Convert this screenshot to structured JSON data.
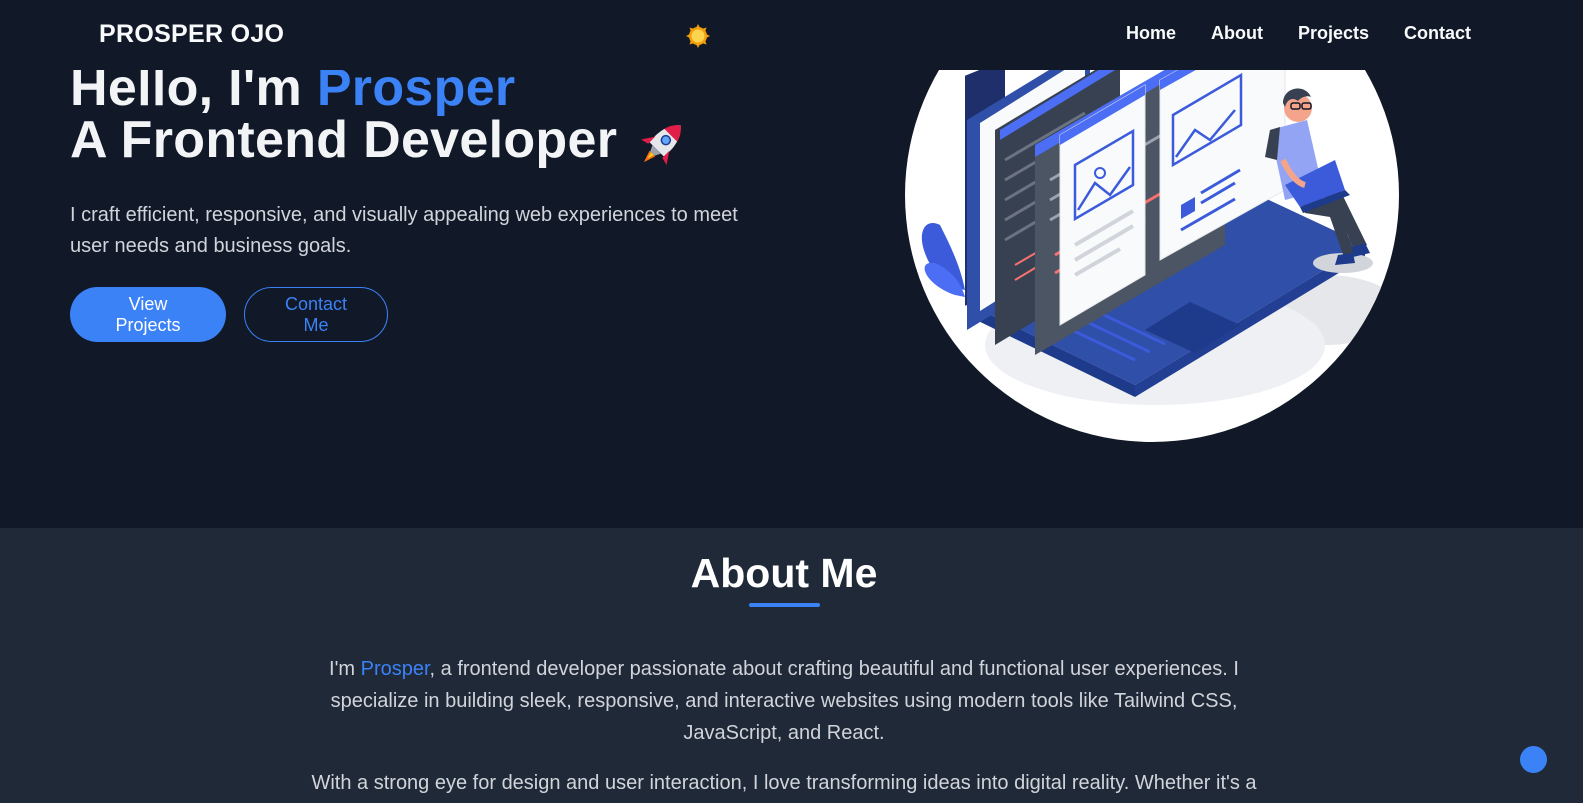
{
  "navbar": {
    "brand": "PROSPER OJO",
    "theme_icon": "sun-icon",
    "links": [
      "Home",
      "About",
      "Projects",
      "Contact"
    ]
  },
  "hero": {
    "title_prefix": "Hello, I'm ",
    "title_name": "Prosper",
    "title_line2": "A Frontend Developer",
    "rocket_icon": "rocket-icon",
    "description": "I craft efficient, responsive, and visually appealing web experiences to meet user needs and business goals.",
    "primary_button": "View Projects",
    "secondary_button": "Contact Me"
  },
  "about": {
    "title": "About Me",
    "p1_prefix": "I'm ",
    "p1_name": "Prosper",
    "p1_rest": ", a frontend developer passionate about crafting beautiful and functional user experiences. I specialize in building sleek, responsive, and interactive websites using modern tools like Tailwind CSS, JavaScript, and React.",
    "p2": "With a strong eye for design and user interaction, I love transforming ideas into digital reality. Whether it's a"
  },
  "colors": {
    "background": "#111827",
    "section_background": "#1f2937",
    "accent": "#3b82f6"
  }
}
